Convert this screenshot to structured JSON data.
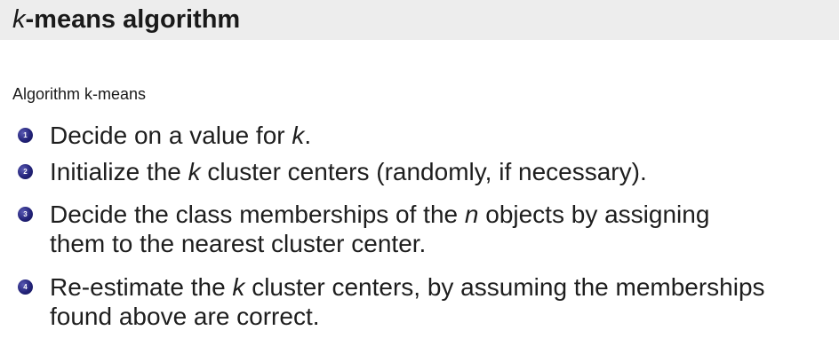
{
  "title": {
    "k": "k",
    "rest": "-means algorithm"
  },
  "algorithm_label": "Algorithm k-means",
  "steps": [
    {
      "number": "1",
      "parts": [
        "Decide on a value for ",
        "k",
        "."
      ]
    },
    {
      "number": "2",
      "parts": [
        "Initialize the ",
        "k",
        " cluster centers (randomly, if necessary)."
      ]
    },
    {
      "number": "3",
      "line1_parts": [
        "Decide the class memberships of the ",
        "n",
        " objects by assigning"
      ],
      "line2": "them to the nearest cluster center."
    },
    {
      "number": "4",
      "line1_parts": [
        "Re-estimate the ",
        "k",
        " cluster centers, by assuming the memberships"
      ],
      "line2": "found above are correct."
    }
  ]
}
